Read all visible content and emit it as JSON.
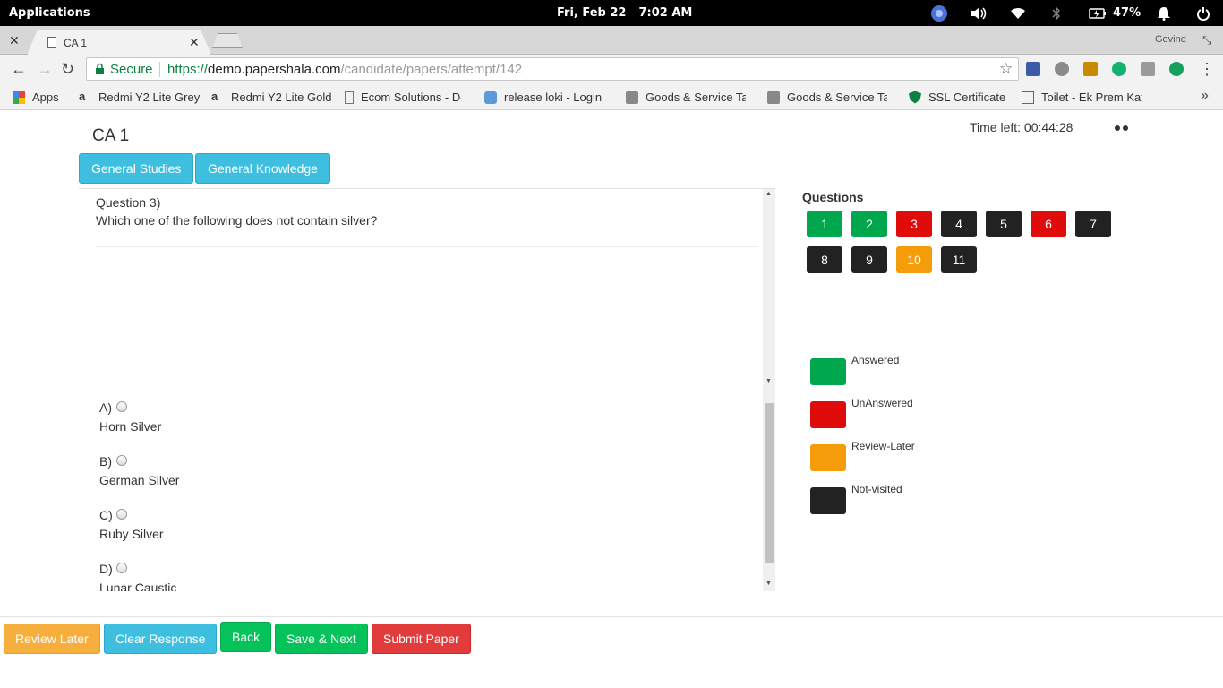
{
  "system_bar": {
    "applications": "Applications",
    "date": "Fri, Feb 22",
    "time": "7:02 AM",
    "battery": "47%"
  },
  "browser": {
    "tab_title": "CA 1",
    "profile": "Govind",
    "address": {
      "secure_label": "Secure",
      "scheme": "https://",
      "host": "demo.papershala.com",
      "path": "/candidate/papers/attempt/142"
    },
    "bookmarks": [
      {
        "label": "Apps",
        "icon": "apps-grid-icon"
      },
      {
        "label": "Redmi Y2 Lite Grey",
        "icon": "amazon-icon"
      },
      {
        "label": "Redmi Y2 Lite Gold",
        "icon": "amazon-icon"
      },
      {
        "label": "Ecom Solutions - De",
        "icon": "page-icon"
      },
      {
        "label": "release loki - Login s",
        "icon": "eos-icon"
      },
      {
        "label": "Goods & Service Ta",
        "icon": "emblem-icon"
      },
      {
        "label": "Goods & Service Ta",
        "icon": "emblem-icon"
      },
      {
        "label": "SSL Certificate",
        "icon": "shield-icon"
      },
      {
        "label": "Toilet - Ek Prem Kath",
        "icon": "film-icon"
      }
    ]
  },
  "exam": {
    "title": "CA 1",
    "time_left": "Time left: 00:44:28",
    "sections": [
      "General Studies",
      "General Knowledge"
    ],
    "question": {
      "number": "Question 3)",
      "text": "Which one of the following does not contain silver?",
      "options": [
        {
          "letter": "A)",
          "text": "Horn Silver"
        },
        {
          "letter": "B)",
          "text": "German Silver"
        },
        {
          "letter": "C)",
          "text": "Ruby Silver"
        },
        {
          "letter": "D)",
          "text": "Lunar Caustic"
        }
      ]
    },
    "palette": {
      "title": "Questions",
      "items": [
        {
          "label": "1",
          "status": "answered"
        },
        {
          "label": "2",
          "status": "answered"
        },
        {
          "label": "3",
          "status": "unanswered"
        },
        {
          "label": "4",
          "status": "not-visited"
        },
        {
          "label": "5",
          "status": "not-visited"
        },
        {
          "label": "6",
          "status": "unanswered"
        },
        {
          "label": "7",
          "status": "not-visited"
        },
        {
          "label": "8",
          "status": "not-visited"
        },
        {
          "label": "9",
          "status": "not-visited"
        },
        {
          "label": "10",
          "status": "review-later"
        },
        {
          "label": "11",
          "status": "not-visited"
        }
      ]
    },
    "legend": [
      {
        "label": "Answered",
        "color": "#00a74d"
      },
      {
        "label": "UnAnswered",
        "color": "#e00b0b"
      },
      {
        "label": "Review-Later",
        "color": "#f59c0b"
      },
      {
        "label": "Not-visited",
        "color": "#222222"
      }
    ],
    "actions": {
      "review_later": "Review Later",
      "clear_response": "Clear Response",
      "back": "Back",
      "save_next": "Save & Next",
      "submit": "Submit Paper"
    }
  },
  "colors": {
    "answered": "#00a74d",
    "unanswered": "#e00b0b",
    "review-later": "#f59c0b",
    "not-visited": "#222222",
    "info": "#3ebfe0",
    "warning": "#f6ae3d",
    "success": "#06c25a",
    "danger": "#e13b3b"
  }
}
